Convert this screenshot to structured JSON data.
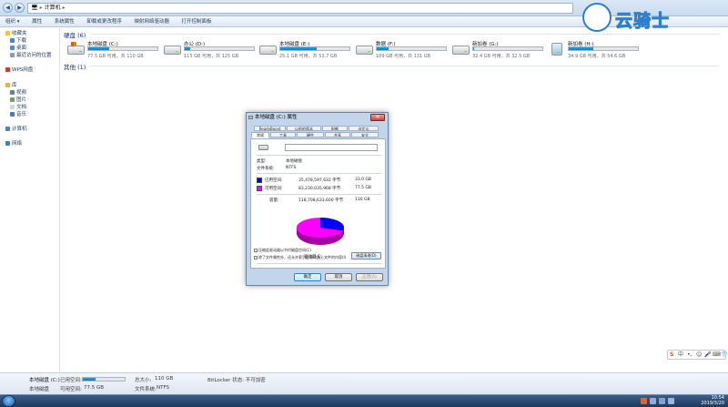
{
  "address_bar": {
    "breadcrumb": [
      "计算机"
    ],
    "back_icon": "arrow-left-icon",
    "forward_icon": "arrow-right-icon"
  },
  "toolbar": {
    "items": [
      "组织 ▾",
      "属性",
      "系统属性",
      "卸载或更改程序",
      "映射网络驱动器",
      "打开控制面板"
    ]
  },
  "sidebar": {
    "favorites": {
      "label": "收藏夹",
      "items": [
        "下载",
        "桌面",
        "最近访问的位置"
      ]
    },
    "wps": "WPS网盘",
    "libraries": {
      "label": "库",
      "items": [
        "视频",
        "图片",
        "文档",
        "音乐"
      ]
    },
    "computer": "计算机",
    "network": "网络"
  },
  "main": {
    "group_hdd": "硬盘 (6)",
    "group_other": "其他 (1)",
    "drives": [
      {
        "name": "本地磁盘 (C:)",
        "info": "77.5 GB 可用，共 110 GB",
        "used_fraction": 0.3,
        "type": "sys"
      },
      {
        "name": "办公 (D:)",
        "info": "115 GB 可用，共 125 GB",
        "used_fraction": 0.08,
        "type": "hdd"
      },
      {
        "name": "本地磁盘 (E:)",
        "info": "25.1 GB 可用，共 53.7 GB",
        "used_fraction": 0.53,
        "type": "hdd"
      },
      {
        "name": "数据 (F:)",
        "info": "109 GB 可用，共 131 GB",
        "used_fraction": 0.17,
        "type": "hdd"
      },
      {
        "name": "新加卷 (G:)",
        "info": "32.4 GB 可用，共 32.5 GB",
        "used_fraction": 0.01,
        "type": "hdd"
      },
      {
        "name": "新加卷 (H:)",
        "info": "34.9 GB 可用，共 54.6 GB",
        "used_fraction": 0.36,
        "type": "usb"
      }
    ]
  },
  "dialog": {
    "title": "本地磁盘 (C:) 属性",
    "close": "✕",
    "tabs_row1": [
      "ReadyBoost",
      "以前的版本",
      "配额",
      "自定义"
    ],
    "tabs_row2": [
      "常规",
      "工具",
      "硬件",
      "共享",
      "安全"
    ],
    "type_label": "类型:",
    "type_value": "本地磁盘",
    "fs_label": "文件系统:",
    "fs_value": "NTFS",
    "used_label": "已用空间:",
    "used_bytes": "35,478,597,632 字节",
    "used_gb": "33.0 GB",
    "free_label": "可用空间:",
    "free_bytes": "83,230,035,968 字节",
    "free_gb": "77.5 GB",
    "capacity_label": "容量:",
    "capacity_bytes": "118,708,633,600 字节",
    "capacity_gb": "110 GB",
    "drive_label": "驱动器 C:",
    "cleanup_button": "磁盘清理(D)",
    "compress_option": "压缩此驱动器以节约磁盘空间(C)",
    "index_option": "除了文件属性外，还允许索引此驱动器上文件的内容(I)",
    "ok": "确定",
    "cancel": "取消",
    "apply": "应用(A)",
    "used_color": "#0000ff",
    "free_color": "#ff00ff",
    "used_fraction": 0.3
  },
  "details": {
    "name": "本地磁盘 (C:)",
    "type": "本地磁盘",
    "used_label": "已用空间:",
    "free_label": "可用空间:",
    "free_value": "77.5 GB",
    "total_label": "总大小:",
    "total_value": "110 GB",
    "fs_label": "文件系统:",
    "fs_value": "NTFS",
    "bitlocker": "BitLocker 状态: 不可加密",
    "used_fraction": 0.3
  },
  "ime": {
    "logo": "S",
    "mode": "中"
  },
  "taskbar": {
    "time": "10:54",
    "date": "2019/3/20"
  },
  "watermark": {
    "text": "云骑士"
  }
}
